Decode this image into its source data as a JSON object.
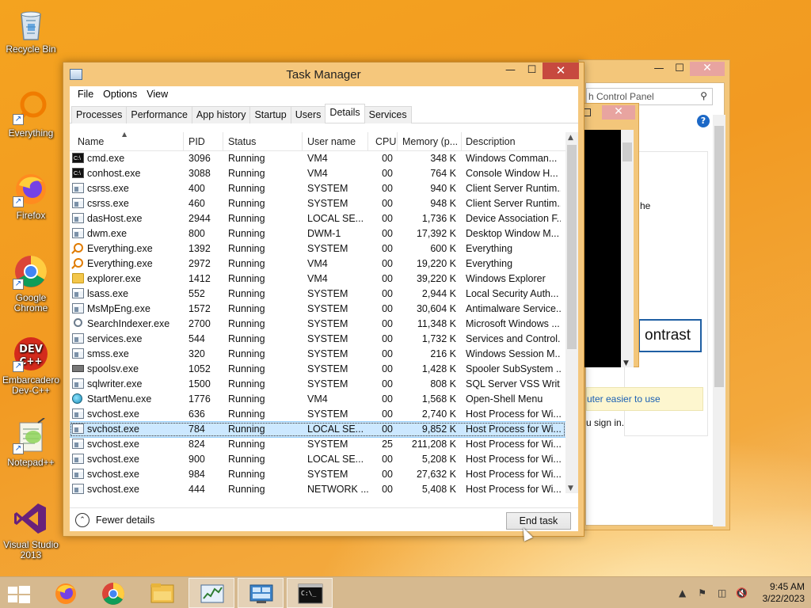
{
  "desktop": {
    "icons": [
      {
        "label": "Recycle Bin",
        "icon": "recycle-bin-icon"
      },
      {
        "label": "Everything",
        "icon": "everything-icon"
      },
      {
        "label": "Firefox",
        "icon": "firefox-icon"
      },
      {
        "label": "Google Chrome",
        "icon": "chrome-icon"
      },
      {
        "label": "Embarcadero Dev-C++",
        "icon": "devcpp-icon"
      },
      {
        "label": "Notepad++",
        "icon": "notepadpp-icon"
      },
      {
        "label": "Visual Studio 2013",
        "icon": "visual-studio-icon"
      }
    ]
  },
  "control_panel": {
    "search_placeholder": "h Control Panel",
    "text_fragment_1": "he",
    "contrast_button": "ontrast",
    "easier_link": "uter easier to use",
    "signin_text": "u sign in."
  },
  "task_manager": {
    "title": "Task Manager",
    "menu": [
      "File",
      "Options",
      "View"
    ],
    "tabs": [
      "Processes",
      "Performance",
      "App history",
      "Startup",
      "Users",
      "Details",
      "Services"
    ],
    "active_tab": "Details",
    "columns": [
      "Name",
      "PID",
      "Status",
      "User name",
      "CPU",
      "Memory (p...",
      "Description"
    ],
    "rows": [
      {
        "icon": "console",
        "name": "cmd.exe",
        "pid": "3096",
        "status": "Running",
        "user": "VM4",
        "cpu": "00",
        "mem": "348 K",
        "desc": "Windows Comman..."
      },
      {
        "icon": "console",
        "name": "conhost.exe",
        "pid": "3088",
        "status": "Running",
        "user": "VM4",
        "cpu": "00",
        "mem": "764 K",
        "desc": "Console Window H..."
      },
      {
        "icon": "app",
        "name": "csrss.exe",
        "pid": "400",
        "status": "Running",
        "user": "SYSTEM",
        "cpu": "00",
        "mem": "940 K",
        "desc": "Client Server Runtim..."
      },
      {
        "icon": "app",
        "name": "csrss.exe",
        "pid": "460",
        "status": "Running",
        "user": "SYSTEM",
        "cpu": "00",
        "mem": "948 K",
        "desc": "Client Server Runtim..."
      },
      {
        "icon": "app",
        "name": "dasHost.exe",
        "pid": "2944",
        "status": "Running",
        "user": "LOCAL SE...",
        "cpu": "00",
        "mem": "1,736 K",
        "desc": "Device Association F..."
      },
      {
        "icon": "app",
        "name": "dwm.exe",
        "pid": "800",
        "status": "Running",
        "user": "DWM-1",
        "cpu": "00",
        "mem": "17,392 K",
        "desc": "Desktop Window M..."
      },
      {
        "icon": "everything",
        "name": "Everything.exe",
        "pid": "1392",
        "status": "Running",
        "user": "SYSTEM",
        "cpu": "00",
        "mem": "600 K",
        "desc": "Everything"
      },
      {
        "icon": "everything",
        "name": "Everything.exe",
        "pid": "2972",
        "status": "Running",
        "user": "VM4",
        "cpu": "00",
        "mem": "19,220 K",
        "desc": "Everything"
      },
      {
        "icon": "folder",
        "name": "explorer.exe",
        "pid": "1412",
        "status": "Running",
        "user": "VM4",
        "cpu": "00",
        "mem": "39,220 K",
        "desc": "Windows Explorer"
      },
      {
        "icon": "app",
        "name": "lsass.exe",
        "pid": "552",
        "status": "Running",
        "user": "SYSTEM",
        "cpu": "00",
        "mem": "2,944 K",
        "desc": "Local Security Auth..."
      },
      {
        "icon": "app",
        "name": "MsMpEng.exe",
        "pid": "1572",
        "status": "Running",
        "user": "SYSTEM",
        "cpu": "00",
        "mem": "30,604 K",
        "desc": "Antimalware Service..."
      },
      {
        "icon": "search",
        "name": "SearchIndexer.exe",
        "pid": "2700",
        "status": "Running",
        "user": "SYSTEM",
        "cpu": "00",
        "mem": "11,348 K",
        "desc": "Microsoft Windows ..."
      },
      {
        "icon": "app",
        "name": "services.exe",
        "pid": "544",
        "status": "Running",
        "user": "SYSTEM",
        "cpu": "00",
        "mem": "1,732 K",
        "desc": "Services and Control..."
      },
      {
        "icon": "app",
        "name": "smss.exe",
        "pid": "320",
        "status": "Running",
        "user": "SYSTEM",
        "cpu": "00",
        "mem": "216 K",
        "desc": "Windows Session M..."
      },
      {
        "icon": "printer",
        "name": "spoolsv.exe",
        "pid": "1052",
        "status": "Running",
        "user": "SYSTEM",
        "cpu": "00",
        "mem": "1,428 K",
        "desc": "Spooler SubSystem ..."
      },
      {
        "icon": "app",
        "name": "sqlwriter.exe",
        "pid": "1500",
        "status": "Running",
        "user": "SYSTEM",
        "cpu": "00",
        "mem": "808 K",
        "desc": "SQL Server VSS Writ..."
      },
      {
        "icon": "globe",
        "name": "StartMenu.exe",
        "pid": "1776",
        "status": "Running",
        "user": "VM4",
        "cpu": "00",
        "mem": "1,568 K",
        "desc": "Open-Shell Menu"
      },
      {
        "icon": "app",
        "name": "svchost.exe",
        "pid": "636",
        "status": "Running",
        "user": "SYSTEM",
        "cpu": "00",
        "mem": "2,740 K",
        "desc": "Host Process for Wi..."
      },
      {
        "icon": "app",
        "name": "svchost.exe",
        "pid": "784",
        "status": "Running",
        "user": "LOCAL SE...",
        "cpu": "00",
        "mem": "9,852 K",
        "desc": "Host Process for Wi...",
        "selected": true
      },
      {
        "icon": "app",
        "name": "svchost.exe",
        "pid": "824",
        "status": "Running",
        "user": "SYSTEM",
        "cpu": "25",
        "mem": "211,208 K",
        "desc": "Host Process for Wi..."
      },
      {
        "icon": "app",
        "name": "svchost.exe",
        "pid": "900",
        "status": "Running",
        "user": "LOCAL SE...",
        "cpu": "00",
        "mem": "5,208 K",
        "desc": "Host Process for Wi..."
      },
      {
        "icon": "app",
        "name": "svchost.exe",
        "pid": "984",
        "status": "Running",
        "user": "SYSTEM",
        "cpu": "00",
        "mem": "27,632 K",
        "desc": "Host Process for Wi..."
      },
      {
        "icon": "app",
        "name": "svchost.exe",
        "pid": "444",
        "status": "Running",
        "user": "NETWORK ...",
        "cpu": "00",
        "mem": "5,408 K",
        "desc": "Host Process for Wi..."
      }
    ],
    "fewer_details": "Fewer details",
    "end_task": "End task"
  },
  "taskbar": {
    "pinned": [
      "start-icon",
      "firefox-icon",
      "chrome-icon",
      "file-explorer-icon",
      "task-manager-icon",
      "control-panel-icon",
      "cmd-icon"
    ],
    "clock_time": "9:45 AM",
    "clock_date": "3/22/2023"
  }
}
